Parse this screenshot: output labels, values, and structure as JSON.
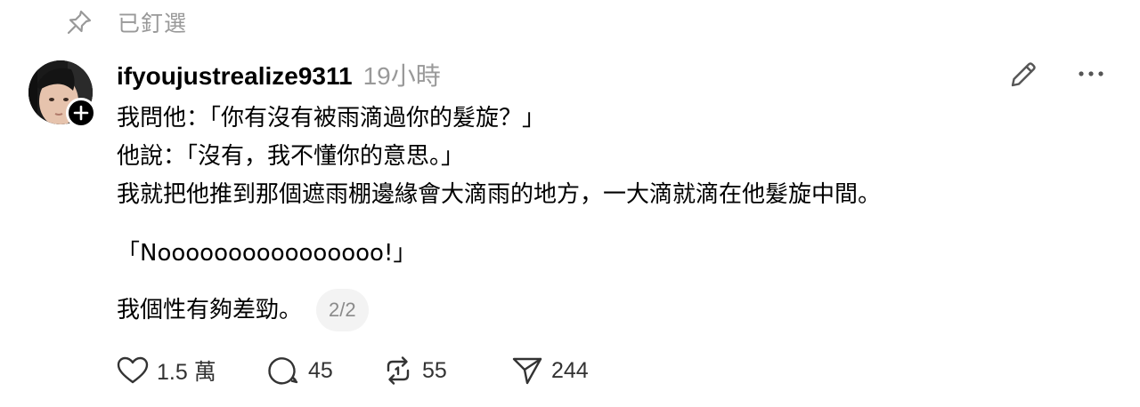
{
  "pinned": {
    "icon": "pin-icon",
    "label": "已釘選"
  },
  "post": {
    "author": {
      "username": "ifyoujustrealize9311",
      "avatar_icon": "avatar",
      "follow_icon": "plus-icon"
    },
    "timestamp": "19小時",
    "lines": [
      "我問他：「你有沒有被雨滴過你的髮旋？」",
      "他說：「沒有，我不懂你的意思。」",
      "我就把他推到那個遮雨棚邊緣會大滴雨的地方，一大滴就滴在他髮旋中間。",
      "「Noooooooooooooooo!」",
      "我個性有夠差勁。"
    ],
    "page_indicator": "2/2",
    "actions": {
      "like": {
        "icon": "heart-icon",
        "count": "1.5 萬"
      },
      "reply": {
        "icon": "comment-icon",
        "count": "45"
      },
      "repost": {
        "icon": "repost-icon",
        "count": "55"
      },
      "share": {
        "icon": "send-icon",
        "count": "244"
      }
    },
    "toolbar": {
      "edit_icon": "pencil-icon",
      "more_icon": "more-icon"
    }
  },
  "colors": {
    "text": "#000000",
    "muted": "#999999",
    "icon": "#333333",
    "pill_bg": "#f3f3f3"
  }
}
